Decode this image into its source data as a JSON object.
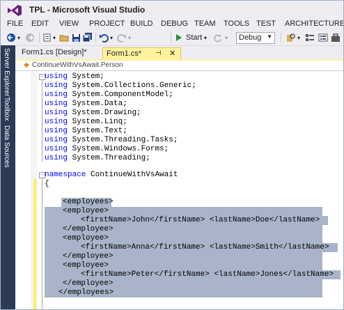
{
  "window": {
    "title": "TPL - Microsoft Visual Studio"
  },
  "menu": [
    "FILE",
    "EDIT",
    "VIEW",
    "PROJECT",
    "BUILD",
    "DEBUG",
    "TEAM",
    "TOOLS",
    "TEST",
    "ARCHITECTURE"
  ],
  "toolbar": {
    "start_label": "Start",
    "config_value": "Debug"
  },
  "left_dock": {
    "tabs": [
      "Server Explorer",
      "Toolbox",
      "Data Sources"
    ]
  },
  "tabs": {
    "inactive": "Form1.cs [Design]*",
    "active": "Form1.cs*"
  },
  "navbar": {
    "member": "ContinueWithVsAwait.Person"
  },
  "code": {
    "using_keyword": "using",
    "usings": [
      "System;",
      "System.Collections.Generic;",
      "System.ComponentModel;",
      "System.Data;",
      "System.Drawing;",
      "System.Linq;",
      "System.Text;",
      "System.Threading.Tasks;",
      "System.Windows.Forms;",
      "System.Threading;"
    ],
    "namespace_keyword": "namespace",
    "namespace_name": "ContinueWithVsAwait",
    "open_brace": "{",
    "xml_lines": [
      "<employees>",
      "<employee>",
      "<firstName>John</firstName> <lastName>Doe</lastName>",
      "</employee>",
      "<employee>",
      "<firstName>Anna</firstName> <lastName>Smith</lastName>",
      "</employee>",
      "<employee>",
      "<firstName>Peter</firstName> <lastName>Jones</lastName>",
      "</employee>",
      "</employees>"
    ]
  },
  "colors": {
    "keyword": "#0000ff",
    "selection": "#a9b3c9",
    "active_tab": "#fff29d",
    "dock": "#2b3a55"
  }
}
